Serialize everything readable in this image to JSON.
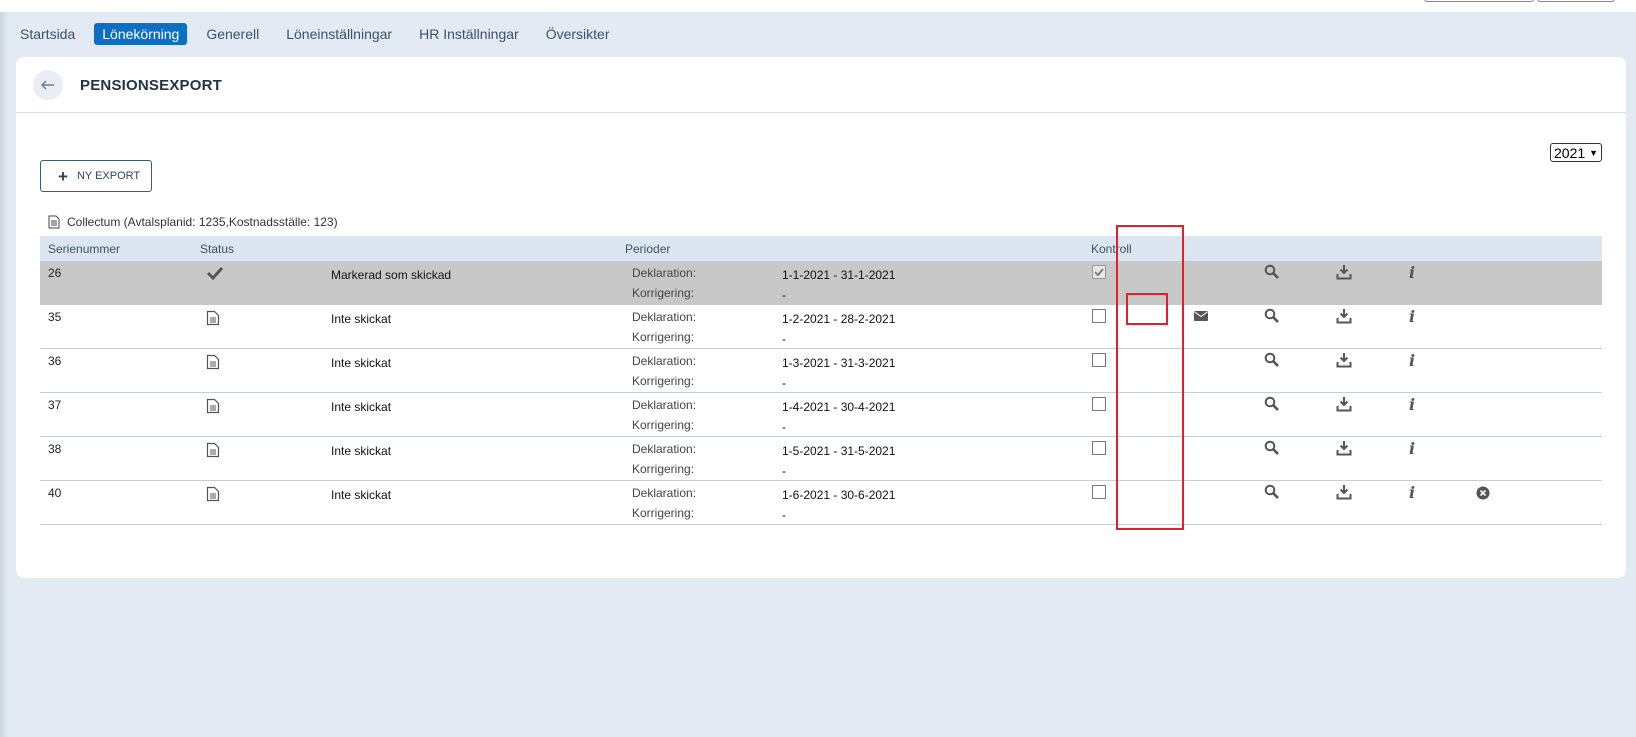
{
  "nav": {
    "items": [
      {
        "label": "Startsida",
        "active": false
      },
      {
        "label": "Lönekörning",
        "active": true
      },
      {
        "label": "Generell",
        "active": false
      },
      {
        "label": "Löneinställningar",
        "active": false
      },
      {
        "label": "HR Inställningar",
        "active": false
      },
      {
        "label": "Översikter",
        "active": false
      }
    ]
  },
  "page": {
    "title": "PENSIONSEXPORT",
    "year": "2021",
    "new_export_label": "NY EXPORT",
    "collectum_label": "Collectum (Avtalsplanid: 1235,Kostnadsställe: 123)"
  },
  "table": {
    "headers": {
      "serial": "Serienummer",
      "status": "Status",
      "periods": "Perioder",
      "control": "Kontroll"
    },
    "declaration_label": "Deklaration:",
    "correction_label": "Korrigering:",
    "rows": [
      {
        "serial": "26",
        "status_icon": "checkmark-icon",
        "status": "Markerad som skickad",
        "declaration": "1-1-2021 - 31-1-2021",
        "correction": "-",
        "checked": true,
        "mail": false,
        "delete": false
      },
      {
        "serial": "35",
        "status_icon": "document-icon",
        "status": "Inte skickat",
        "declaration": "1-2-2021 - 28-2-2021",
        "correction": "-",
        "checked": false,
        "mail": true,
        "delete": false
      },
      {
        "serial": "36",
        "status_icon": "document-icon",
        "status": "Inte skickat",
        "declaration": "1-3-2021 - 31-3-2021",
        "correction": "-",
        "checked": false,
        "mail": false,
        "delete": false
      },
      {
        "serial": "37",
        "status_icon": "document-icon",
        "status": "Inte skickat",
        "declaration": "1-4-2021 - 30-4-2021",
        "correction": "-",
        "checked": false,
        "mail": false,
        "delete": false
      },
      {
        "serial": "38",
        "status_icon": "document-icon",
        "status": "Inte skickat",
        "declaration": "1-5-2021 - 31-5-2021",
        "correction": "-",
        "checked": false,
        "mail": false,
        "delete": false
      },
      {
        "serial": "40",
        "status_icon": "document-icon",
        "status": "Inte skickat",
        "declaration": "1-6-2021 - 30-6-2021",
        "correction": "-",
        "checked": false,
        "mail": false,
        "delete": true
      }
    ]
  },
  "colors": {
    "accent": "#0c6fc2",
    "highlight": "#e0202a",
    "sent_row": "#c8c8c8"
  }
}
